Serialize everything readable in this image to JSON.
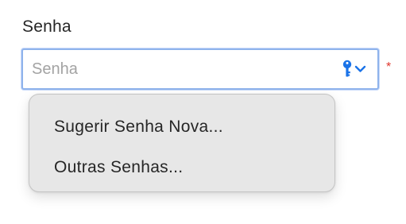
{
  "password_field": {
    "label": "Senha",
    "placeholder": "Senha",
    "value": "",
    "required_marker": "*",
    "key_icon": "key-icon",
    "chevron_icon": "chevron-down-icon"
  },
  "password_menu": {
    "items": [
      {
        "label": "Sugerir Senha Nova..."
      },
      {
        "label": "Outras Senhas..."
      }
    ]
  },
  "colors": {
    "accent": "#1a73e8",
    "focus_border": "#8fb3ec",
    "required": "#e0362d",
    "menu_background": "#e7e7e7"
  }
}
